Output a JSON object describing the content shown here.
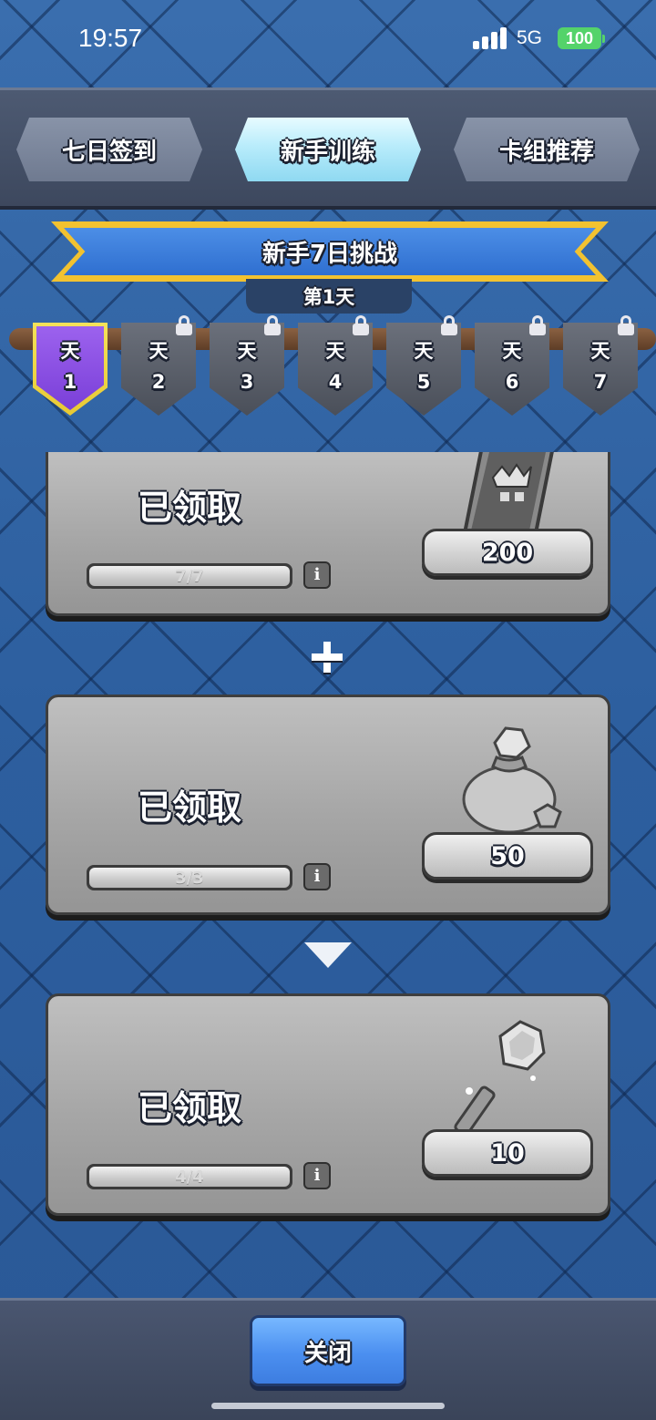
{
  "status_bar": {
    "time": "19:57",
    "network": "5G",
    "battery": "100"
  },
  "tabs": [
    {
      "label": "七日签到",
      "active": false
    },
    {
      "label": "新手训练",
      "active": true
    },
    {
      "label": "卡组推荐",
      "active": false
    }
  ],
  "banner": {
    "title": "新手7日挑战",
    "day_label": "第1天"
  },
  "days": [
    {
      "top": "天",
      "num": "1",
      "locked": false,
      "selected": true
    },
    {
      "top": "天",
      "num": "2",
      "locked": true,
      "selected": false
    },
    {
      "top": "天",
      "num": "3",
      "locked": true,
      "selected": false
    },
    {
      "top": "天",
      "num": "4",
      "locked": true,
      "selected": false
    },
    {
      "top": "天",
      "num": "5",
      "locked": true,
      "selected": false
    },
    {
      "top": "天",
      "num": "6",
      "locked": true,
      "selected": false
    },
    {
      "top": "天",
      "num": "7",
      "locked": true,
      "selected": false
    }
  ],
  "rewards": [
    {
      "status": "已领取",
      "progress": "7/7",
      "progress_value": 1.0,
      "amount": "200",
      "icon": "banner-token-icon"
    },
    {
      "status": "已领取",
      "progress": "3/3",
      "progress_value": 1.0,
      "amount": "50",
      "icon": "gem-bag-icon"
    },
    {
      "status": "已领取",
      "progress": "4/4",
      "progress_value": 1.0,
      "amount": "10",
      "icon": "crystal-wand-icon"
    }
  ],
  "info_symbol": "i",
  "footer": {
    "close_label": "关闭"
  },
  "colors": {
    "accent_blue": "#4b8ff0",
    "banner_gold": "#f2c230",
    "selected_day": "#7a3fd8"
  }
}
